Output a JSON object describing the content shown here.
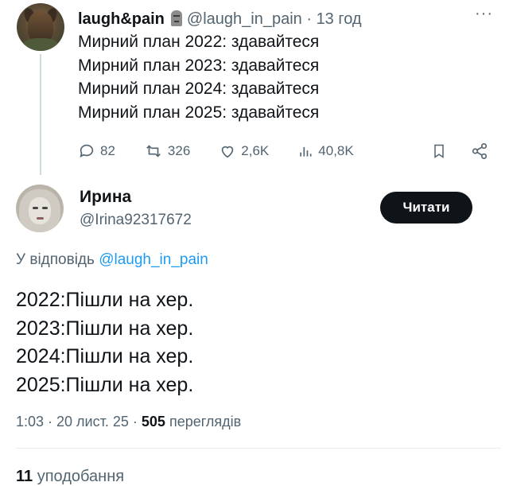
{
  "tweet1": {
    "name": "laugh&pain",
    "handle": "@laugh_in_pain",
    "separator": "·",
    "time": "13 год",
    "more": "···",
    "lines": [
      "Мирний план 2022: здавайтеся",
      "Мирний план 2023: здавайтеся",
      "Мирний план 2024: здавайтеся",
      "Мирний план 2025: здавайтеся"
    ],
    "actions": {
      "replies": "82",
      "reposts": "326",
      "likes": "2,6K",
      "views": "40,8K"
    }
  },
  "tweet2": {
    "name": "Ирина",
    "handle": "@Irina92317672",
    "follow_label": "Читати",
    "reply_prefix": "У відповідь",
    "reply_mention": "@laugh_in_pain",
    "lines": [
      "2022:Пішли на хер.",
      "2023:Пішли на хер.",
      "2024:Пішли на хер.",
      "2025:Пішли на хер."
    ],
    "meta_time": "1:03 · 20 лист. 25 ·",
    "meta_views_count": "505",
    "meta_views_label": "переглядів",
    "likes_count": "11",
    "likes_label": "уподобання"
  },
  "colors": {
    "text": "#0f1419",
    "secondary": "#536471",
    "link": "#1d9bf0",
    "button_bg": "#0f1419",
    "divider": "#e6ecf0"
  },
  "icons": [
    "reply-icon",
    "repost-icon",
    "heart-icon",
    "views-icon",
    "bookmark-icon",
    "share-icon",
    "more-icon"
  ]
}
